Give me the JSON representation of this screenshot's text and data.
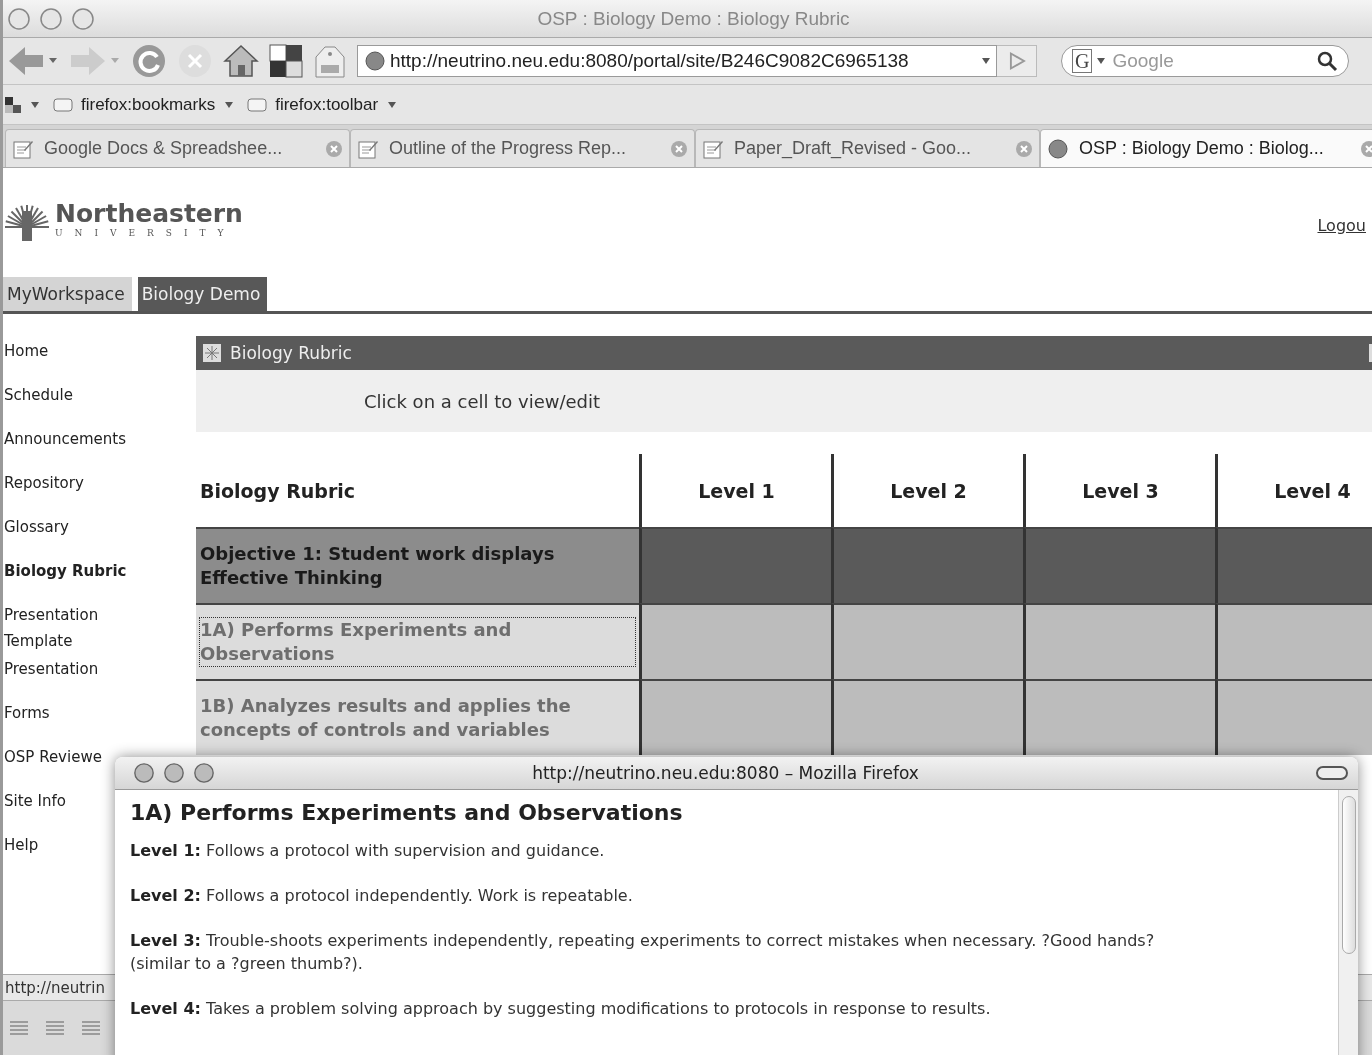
{
  "window": {
    "title": "OSP : Biology Demo : Biology Rubric"
  },
  "address": {
    "url": "http://neutrino.neu.edu:8080/portal/site/B246C9082C6965138"
  },
  "search": {
    "engine": "G",
    "placeholder": "Google"
  },
  "bookmarks": [
    {
      "label": "firefox:bookmarks"
    },
    {
      "label": "firefox:toolbar"
    }
  ],
  "browser_tabs": [
    {
      "label": "Google Docs & Spreadshee...",
      "kind": "doc",
      "selected": false
    },
    {
      "label": "Outline of the Progress Rep...",
      "kind": "doc",
      "selected": false
    },
    {
      "label": "Paper_Draft_Revised - Goo...",
      "kind": "doc",
      "selected": false
    },
    {
      "label": "OSP : Biology Demo : Biolog...",
      "kind": "globe",
      "selected": true
    }
  ],
  "site": {
    "logo_name": "Northeastern",
    "logo_subtitle": "UNIVERSITY",
    "logout": "Logou"
  },
  "site_tabs": [
    {
      "label": "MyWorkspace",
      "selected": false
    },
    {
      "label": "Biology Demo",
      "selected": true
    }
  ],
  "sidebar": {
    "items": [
      {
        "label": "Home",
        "selected": false
      },
      {
        "label": "Schedule",
        "selected": false
      },
      {
        "label": "Announcements",
        "selected": false
      },
      {
        "label": "Repository",
        "selected": false
      },
      {
        "label": "Glossary",
        "selected": false
      },
      {
        "label": "Biology Rubric",
        "selected": true
      },
      {
        "label": "Presentation Template",
        "selected": false
      },
      {
        "label": "Presentation",
        "selected": false
      },
      {
        "label": "Forms",
        "selected": false
      },
      {
        "label": "OSP Reviewe",
        "selected": false
      },
      {
        "label": "Site Info",
        "selected": false
      },
      {
        "label": "Help",
        "selected": false
      }
    ]
  },
  "panel": {
    "title": "Biology Rubric",
    "instruction": "Click on a cell to view/edit"
  },
  "rubric": {
    "columns": [
      "Biology Rubric",
      "Level 1",
      "Level 2",
      "Level 3",
      "Level 4"
    ],
    "rows": [
      {
        "kind": "objective",
        "label": "Objective 1: Student work displays Effective Thinking",
        "focused": false
      },
      {
        "kind": "criterion",
        "label": "1A) Performs Experiments and Observations",
        "focused": true
      },
      {
        "kind": "criterion",
        "label": "1B) Analyzes results and applies the concepts of controls and variables",
        "focused": false
      }
    ]
  },
  "status_bar": {
    "text": "http://neutrin"
  },
  "popup": {
    "title": "http://neutrino.neu.edu:8080 – Mozilla Firefox",
    "heading": "1A) Performs Experiments and Observations",
    "paragraphs": [
      "**Level 1:** Follows a protocol with supervision and guidance.",
      "**Level 2:** Follows a protocol independently. Work is repeatable.",
      "**Level 3:** Trouble-shoots experiments independently, repeating experiments to correct mistakes when necessary. ?Good hands? (similar to a ?green thumb?).",
      "**Level 4:** Takes a problem solving approach by suggesting modifications to protocols in response to results."
    ]
  }
}
